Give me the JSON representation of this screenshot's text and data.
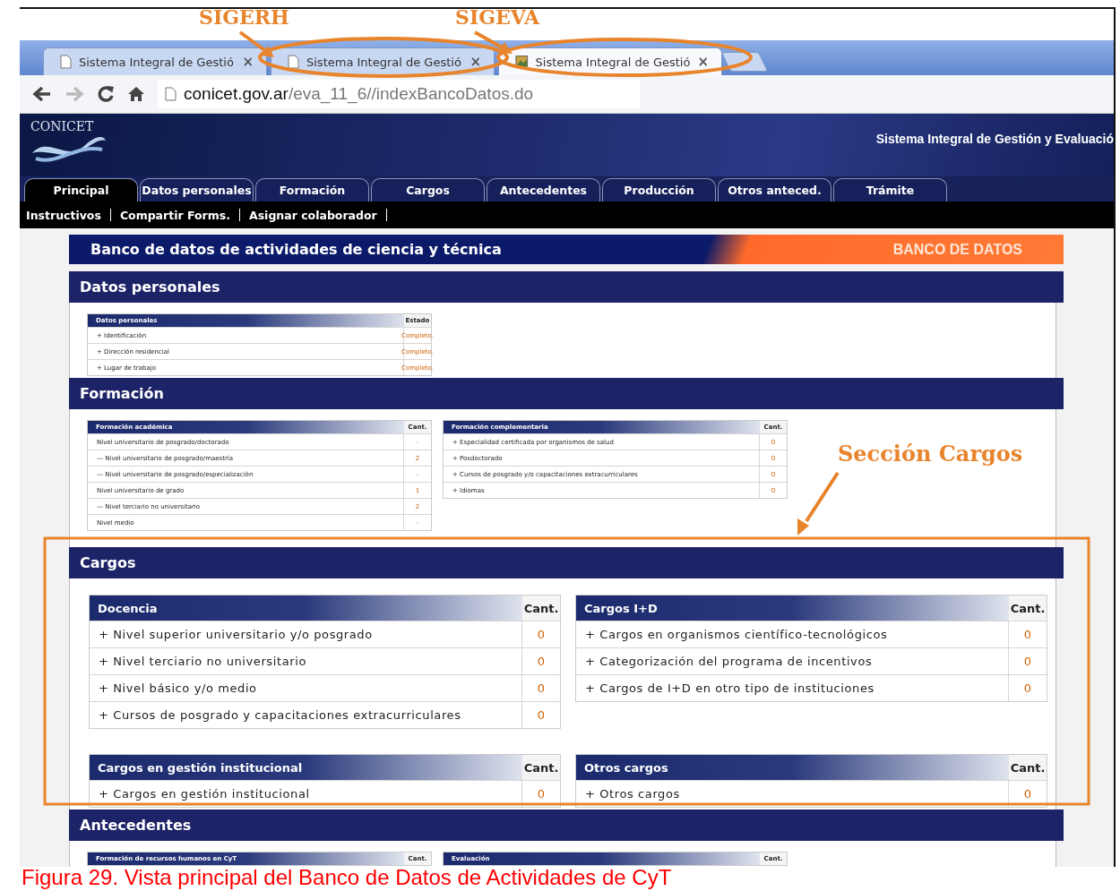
{
  "annotations": [
    {
      "kind": "tab_label",
      "text": "SIGERH"
    },
    {
      "kind": "tab_label",
      "text": "SIGEVA"
    },
    {
      "kind": "section_label",
      "text": "Sección Cargos"
    }
  ],
  "browser": {
    "tabs": [
      {
        "title": "Sistema Integral de Gestió",
        "close": "×",
        "selected": false
      },
      {
        "title": "Sistema Integral de Gestió",
        "close": "×",
        "selected": false
      },
      {
        "title": "Sistema Integral de Gestió",
        "close": "×",
        "selected": true
      }
    ],
    "url_host": "conicet.gov.ar",
    "url_path": "/eva_11_6//indexBancoDatos.do"
  },
  "site": {
    "logo": "CONICET",
    "title": "Sistema Integral de Gestión y Evaluació"
  },
  "nav_tabs": [
    {
      "label": "Principal",
      "selected": true
    },
    {
      "label": "Datos personales",
      "selected": false
    },
    {
      "label": "Formación",
      "selected": false
    },
    {
      "label": "Cargos",
      "selected": false
    },
    {
      "label": "Antecedentes",
      "selected": false
    },
    {
      "label": "Producción",
      "selected": false
    },
    {
      "label": "Otros anteced.",
      "selected": false
    },
    {
      "label": "Trámite",
      "selected": false
    }
  ],
  "sub_nav": [
    "Instructivos",
    "Compartir Forms.",
    "Asignar colaborador"
  ],
  "banner": {
    "title": "Banco de datos de actividades de ciencia y técnica",
    "badge": "BANCO DE DATOS"
  },
  "sections": [
    {
      "title": "Datos personales",
      "kind": "compact",
      "tables": [
        {
          "title": "Datos personales",
          "count_header": "Estado",
          "rows": [
            {
              "label": "+ Identificación",
              "count": "Completo."
            },
            {
              "label": "+ Dirección residencial",
              "count": "Completo."
            },
            {
              "label": "+ Lugar de trabajo",
              "count": "Completo."
            }
          ]
        }
      ]
    },
    {
      "title": "Formación",
      "kind": "compact",
      "tables": [
        {
          "title": "Formación académica",
          "count_header": "Cant.",
          "rows": [
            {
              "label": "Nivel universitario de posgrado/doctorado",
              "count": "-"
            },
            {
              "label": "— Nivel universitario de posgrado/maestría",
              "count": "2"
            },
            {
              "label": "— Nivel universitario de posgrado/especialización",
              "count": "-"
            },
            {
              "label": "Nivel universitario de grado",
              "count": "1"
            },
            {
              "label": "— Nivel terciario no universitario",
              "count": "2"
            },
            {
              "label": "Nivel medio",
              "count": "-"
            }
          ]
        },
        {
          "title": "Formación complementaria",
          "count_header": "Cant.",
          "rows": [
            {
              "label": "+ Especialidad certificada por organismos de salud",
              "count": "0"
            },
            {
              "label": "+ Posdoctorado",
              "count": "0"
            },
            {
              "label": "+ Cursos de posgrado y/o capacitaciones extracurriculares",
              "count": "0"
            },
            {
              "label": "+ Idiomas",
              "count": "0"
            }
          ]
        }
      ]
    },
    {
      "title": "Cargos",
      "kind": "full",
      "tables": [
        {
          "title": "Docencia",
          "count_header": "Cant.",
          "rows": [
            {
              "label": "+ Nivel superior universitario y/o posgrado",
              "count": "0"
            },
            {
              "label": "+ Nivel terciario no universitario",
              "count": "0"
            },
            {
              "label": "+ Nivel básico y/o medio",
              "count": "0"
            },
            {
              "label": "+ Cursos de posgrado y capacitaciones extracurriculares",
              "count": "0"
            }
          ]
        },
        {
          "title": "Cargos I+D",
          "count_header": "Cant.",
          "rows": [
            {
              "label": "+ Cargos en organismos científico-tecnológicos",
              "count": "0"
            },
            {
              "label": "+ Categorización del programa de incentivos",
              "count": "0"
            },
            {
              "label": "+ Cargos de I+D en otro tipo de instituciones",
              "count": "0"
            }
          ]
        },
        {
          "title": "Cargos en gestión institucional",
          "count_header": "Cant.",
          "rows": [
            {
              "label": "+ Cargos en gestión institucional",
              "count": "0"
            }
          ]
        },
        {
          "title": "Otros cargos",
          "count_header": "Cant.",
          "rows": [
            {
              "label": "+ Otros cargos",
              "count": "0"
            }
          ]
        }
      ]
    },
    {
      "title": "Antecedentes",
      "kind": "compact",
      "tables": [
        {
          "title": "Formación de recursos humanos en CyT",
          "count_header": "Cant."
        },
        {
          "title": "Evaluación",
          "count_header": "Cant."
        }
      ]
    }
  ],
  "caption": "Figura 29. Vista principal del Banco de Datos de Actividades de CyT"
}
